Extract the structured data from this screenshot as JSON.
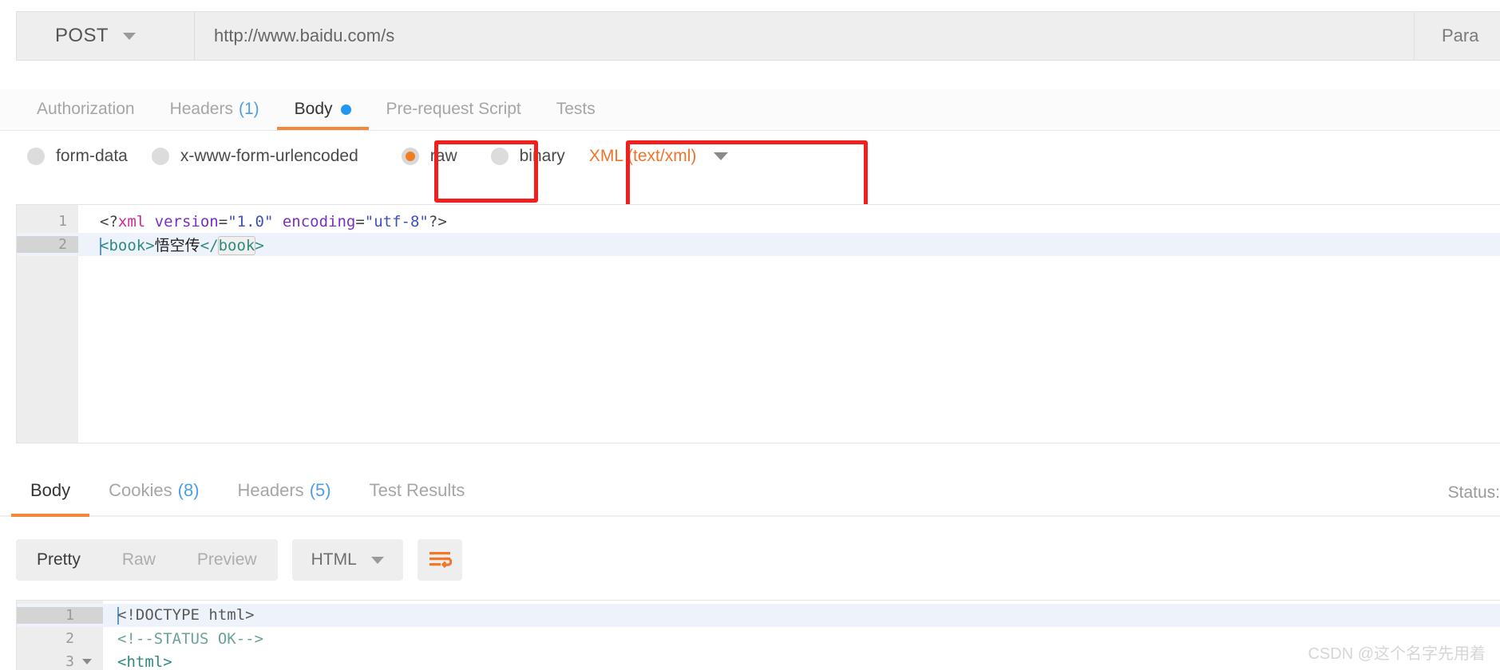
{
  "request_bar": {
    "method": "POST",
    "method_chevron": "chevron-down-icon",
    "url": "http://www.baidu.com/s",
    "params_label": "Para"
  },
  "request_tabs": [
    {
      "label": "Authorization",
      "count": null,
      "active": false,
      "dot": false
    },
    {
      "label": "Headers",
      "count": "(1)",
      "active": false,
      "dot": false
    },
    {
      "label": "Body",
      "count": null,
      "active": true,
      "dot": true
    },
    {
      "label": "Pre-request Script",
      "count": null,
      "active": false,
      "dot": false
    },
    {
      "label": "Tests",
      "count": null,
      "active": false,
      "dot": false
    }
  ],
  "body_type": {
    "options": [
      {
        "label": "form-data",
        "selected": false
      },
      {
        "label": "x-www-form-urlencoded",
        "selected": false
      },
      {
        "label": "raw",
        "selected": true
      },
      {
        "label": "binary",
        "selected": false
      }
    ],
    "content_type_selected": "XML (text/xml)",
    "content_type_chevron": "chevron-down-icon"
  },
  "annotations": [
    {
      "name": "raw-highlight",
      "color": "#f21f1f"
    },
    {
      "name": "content-type-highlight",
      "color": "#f21f1f"
    }
  ],
  "request_editor": {
    "lines": [
      {
        "n": "1",
        "current": false
      },
      {
        "n": "2",
        "current": true
      }
    ],
    "line1": {
      "open": "<?",
      "tag": "xml",
      "attr1": " version",
      "eq1": "=",
      "str1": "\"1.0\"",
      "attr2": " encoding",
      "eq2": "=",
      "str2": "\"utf-8\"",
      "close": "?>"
    },
    "line2": {
      "open_lt": "<",
      "open_tag": "book",
      "open_gt": ">",
      "text": "悟空传",
      "close_lt": "</",
      "close_tag": "book",
      "close_gt": ">"
    }
  },
  "response_tabs": [
    {
      "label": "Body",
      "count": null,
      "active": true
    },
    {
      "label": "Cookies",
      "count": "(8)",
      "active": false
    },
    {
      "label": "Headers",
      "count": "(5)",
      "active": false
    },
    {
      "label": "Test Results",
      "count": null,
      "active": false
    }
  ],
  "response_status_label": "Status:",
  "response_toolbar": {
    "view_modes": [
      {
        "label": "Pretty",
        "active": true
      },
      {
        "label": "Raw",
        "active": false
      },
      {
        "label": "Preview",
        "active": false
      }
    ],
    "format_selected": "HTML",
    "format_chevron": "chevron-down-icon",
    "wrap_icon": "word-wrap-icon"
  },
  "response_editor": {
    "lines": [
      {
        "n": "1",
        "current": true,
        "fold": false,
        "text": "<!DOCTYPE html>",
        "kind": "doctype"
      },
      {
        "n": "2",
        "current": false,
        "fold": false,
        "text": "<!--STATUS OK-->",
        "kind": "comment"
      },
      {
        "n": "3",
        "current": false,
        "fold": true,
        "text": "<html>",
        "kind": "tag"
      }
    ]
  },
  "watermark": "CSDN @这个名字先用着",
  "colors": {
    "accent_orange": "#f2883a",
    "annotation_red": "#f21f1f",
    "tab_blue": "#4a9eea",
    "body_dot_blue": "#2196f3"
  }
}
